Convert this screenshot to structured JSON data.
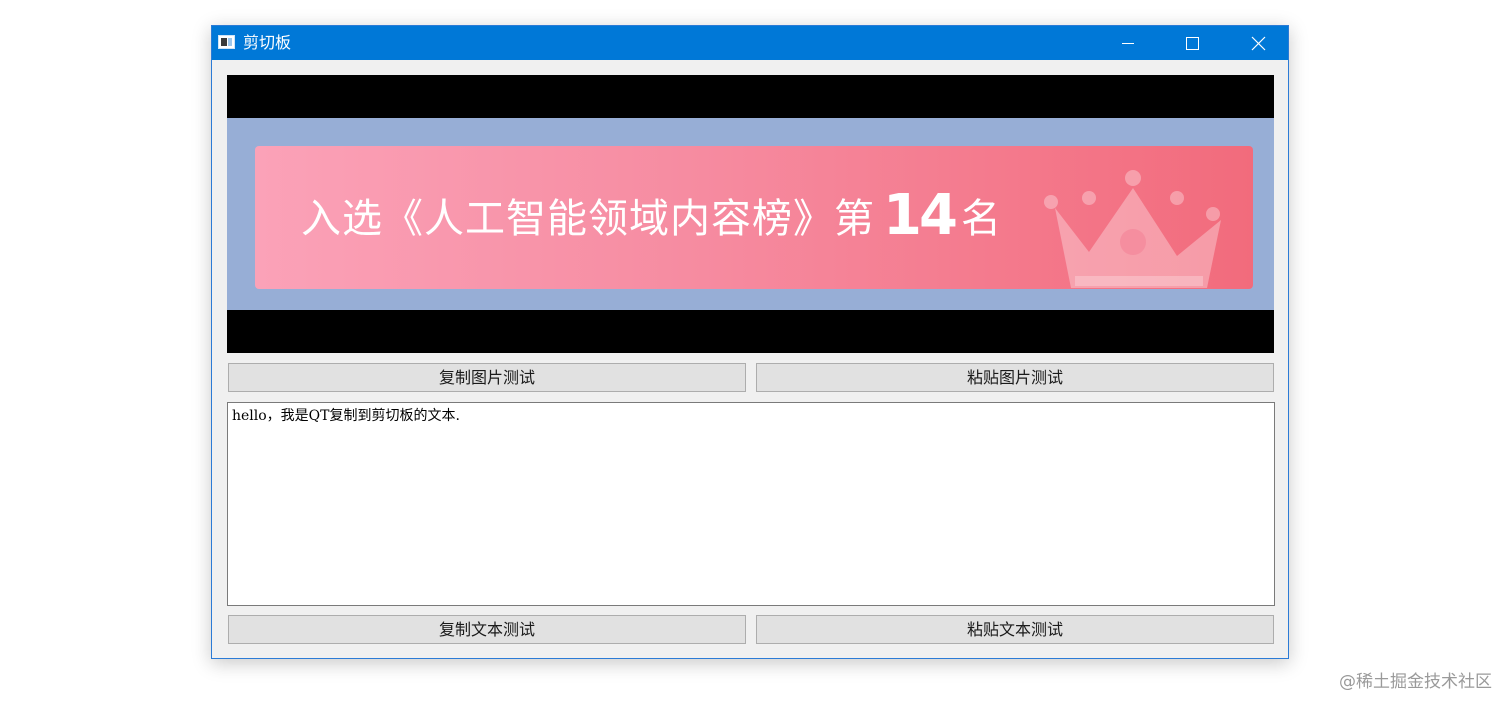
{
  "window": {
    "title": "剪切板",
    "controls": {
      "minimize_icon": "minimize-icon",
      "maximize_icon": "maximize-icon",
      "close_icon": "close-icon"
    }
  },
  "image_preview": {
    "banner_text_before": "入选《人工智能领域内容榜》第",
    "banner_number": "14",
    "banner_text_after": "名",
    "decoration_icon": "crown-icon",
    "colors": {
      "letterbox": "#000000",
      "image_background": "#97aed6",
      "banner_gradient_start": "#fba2b8",
      "banner_gradient_end": "#f26b7c"
    }
  },
  "buttons": {
    "copy_image": "复制图片测试",
    "paste_image": "粘贴图片测试",
    "copy_text": "复制文本测试",
    "paste_text": "粘贴文本测试"
  },
  "text_edit": {
    "value": "hello，我是QT复制到剪切板的文本."
  },
  "watermark": "@稀土掘金技术社区",
  "theme": {
    "titlebar": "#0078d7",
    "window_bg": "#f0f0f0",
    "button_bg": "#e1e1e1"
  }
}
